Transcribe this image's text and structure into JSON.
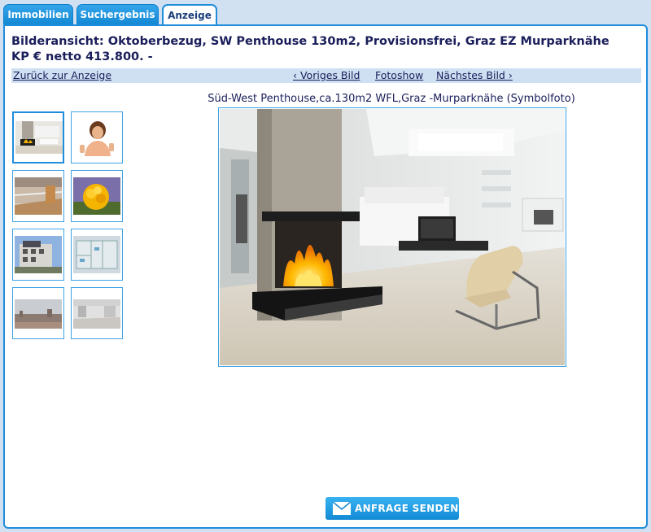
{
  "tabs": [
    {
      "label": "Immobilien"
    },
    {
      "label": "Suchergebnis"
    },
    {
      "label": "Anzeige"
    }
  ],
  "page_title": "Bilderansicht: Oktoberbezug, SW Penthouse 130m2, Provisionsfrei, Graz EZ Murparknähe KP € netto 413.800. -",
  "nav": {
    "back": "Zurück zur Anzeige",
    "prev": "‹ Voriges Bild",
    "slideshow": "Fotoshow",
    "next": "Nächstes Bild ›"
  },
  "image_caption": "Süd-West Penthouse,ca.130m2 WFL,Graz -Murparknähe (Symbolfoto)",
  "thumbnails": [
    {
      "name": "fireplace-living-room"
    },
    {
      "name": "woman-thumbs-up"
    },
    {
      "name": "balcony"
    },
    {
      "name": "yellow-flowers"
    },
    {
      "name": "building-exterior"
    },
    {
      "name": "floor-plan"
    },
    {
      "name": "city-view"
    },
    {
      "name": "empty-room"
    }
  ],
  "contact_button": {
    "label": "ANFRAGE SENDEN",
    "icon": "envelope-icon"
  }
}
